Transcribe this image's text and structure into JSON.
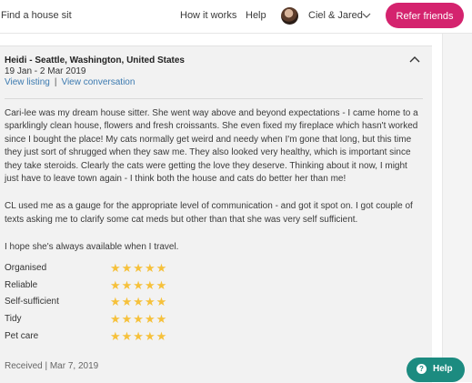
{
  "nav": {
    "find": "Find a house sit",
    "how": "How it works",
    "help": "Help",
    "user": "Ciel & Jared",
    "refer": "Refer friends"
  },
  "review": {
    "reviewer": "Heidi - Seattle, Washington, United States",
    "dates": "19 Jan - 2 Mar 2019",
    "view_listing": "View listing",
    "separator": "|",
    "view_conversation": "View conversation",
    "paragraphs": [
      "Cari-lee was my dream house sitter. She went way above and beyond expectations - I came home to a sparklingly clean house, flowers and fresh croissants. She even fixed my fireplace which hasn't worked since I bought the place! My cats normally get weird and needy when I'm gone that long, but this time they just sort of shrugged when they saw me. They also looked very healthy, which is important since they take steroids. Clearly the cats were getting the love they deserve. Thinking about it now, I might just have to leave town again - I think both the house and cats do better her than me!",
      "CL used me as a gauge for the appropriate level of communication - and got it spot on. I got couple of texts asking me to clarify some cat meds but other than that she was very self sufficient.",
      "I hope she's always available when I travel."
    ],
    "ratings": [
      {
        "label": "Organised",
        "stars": "★★★★★",
        "score": 5
      },
      {
        "label": "Reliable",
        "stars": "★★★★★",
        "score": 5
      },
      {
        "label": "Self-sufficient",
        "stars": "★★★★★",
        "score": 5
      },
      {
        "label": "Tidy",
        "stars": "★★★★★",
        "score": 5
      },
      {
        "label": "Pet care",
        "stars": "★★★★★",
        "score": 5
      }
    ],
    "received": "Received | Mar 7, 2019"
  },
  "help_button": {
    "icon": "?",
    "label": "Help"
  },
  "colors": {
    "accent": "#d4236e",
    "help": "#1c8b80",
    "link": "#3c7ab0",
    "star": "#f6c13b",
    "card_bg": "#f2f2f2"
  },
  "icons": {
    "avatar": "avatar-photo",
    "user_menu": "chevron-down-icon",
    "collapse": "chevron-up-icon",
    "help": "question-icon"
  }
}
